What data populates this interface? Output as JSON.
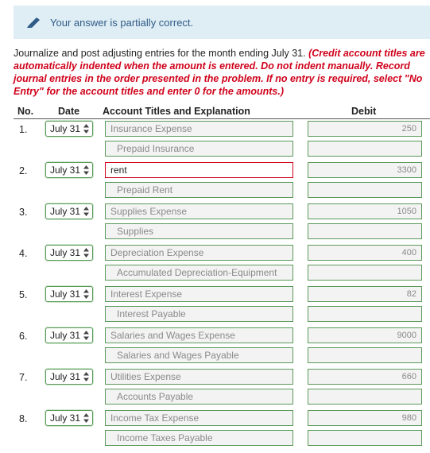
{
  "banner": {
    "text": "Your answer is partially correct.",
    "icon": "pencil-icon"
  },
  "instructions": {
    "text": "Journalize and post adjusting entries for the month ending July 31.",
    "hint": "(Credit account titles are automatically indented when the amount is entered. Do not indent manually. Record journal entries in the order presented in the problem. If no entry is required, select \"No Entry\" for the account titles and enter 0 for the amounts.)"
  },
  "table": {
    "headers": {
      "no": "No.",
      "date": "Date",
      "account": "Account Titles and Explanation",
      "debit": "Debit"
    }
  },
  "entries": [
    {
      "no": "1.",
      "date": "July 31",
      "debit_account": "Insurance Expense",
      "debit_amount": "250",
      "credit_account": "Prepaid Insurance",
      "credit_amount": ""
    },
    {
      "no": "2.",
      "date": "July 31",
      "debit_account": "rent",
      "debit_amount": "3300",
      "credit_account": "Prepaid Rent",
      "credit_amount": ""
    },
    {
      "no": "3.",
      "date": "July 31",
      "debit_account": "Supplies Expense",
      "debit_amount": "1050",
      "credit_account": "Supplies",
      "credit_amount": ""
    },
    {
      "no": "4.",
      "date": "July 31",
      "debit_account": "Depreciation Expense",
      "debit_amount": "400",
      "credit_account": "Accumulated Depreciation-Equipment",
      "credit_amount": ""
    },
    {
      "no": "5.",
      "date": "July 31",
      "debit_account": "Interest Expense",
      "debit_amount": "82",
      "credit_account": "Interest Payable",
      "credit_amount": ""
    },
    {
      "no": "6.",
      "date": "July 31",
      "debit_account": "Salaries and Wages Expense",
      "debit_amount": "9000",
      "credit_account": "Salaries and Wages Payable",
      "credit_amount": ""
    },
    {
      "no": "7.",
      "date": "July 31",
      "debit_account": "Utilities Expense",
      "debit_amount": "660",
      "credit_account": "Accounts Payable",
      "credit_amount": ""
    },
    {
      "no": "8.",
      "date": "July 31",
      "debit_account": "Income Tax Expense",
      "debit_amount": "980",
      "credit_account": "Income Taxes Payable",
      "credit_amount": ""
    }
  ],
  "colors": {
    "correct_border": "#5a9a5a",
    "error_border": "#d0021b",
    "banner_bg": "#dfeef4",
    "hint_red": "#d0021b"
  }
}
